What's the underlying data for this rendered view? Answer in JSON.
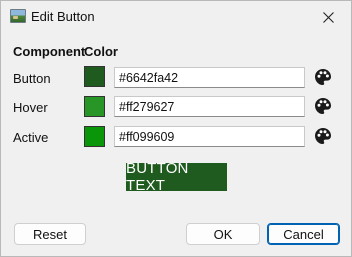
{
  "window": {
    "title": "Edit Button",
    "title_icon": "landscape-image-icon",
    "close_icon": "close-icon"
  },
  "headers": {
    "component": "Component",
    "color": "Color"
  },
  "rows": [
    {
      "label": "Button",
      "hex": "#6642fa42",
      "swatch_color": "#1f5a1f",
      "picker_icon": "palette-icon"
    },
    {
      "label": "Hover",
      "hex": "#ff279627",
      "swatch_color": "#279627",
      "picker_icon": "palette-icon"
    },
    {
      "label": "Active",
      "hex": "#ff099609",
      "swatch_color": "#099609",
      "picker_icon": "palette-icon"
    }
  ],
  "preview": {
    "text": "BUTTON TEXT",
    "background": "#1f5a1f",
    "text_color": "#ffffff"
  },
  "buttons": {
    "reset": "Reset",
    "ok": "OK",
    "cancel": "Cancel"
  }
}
